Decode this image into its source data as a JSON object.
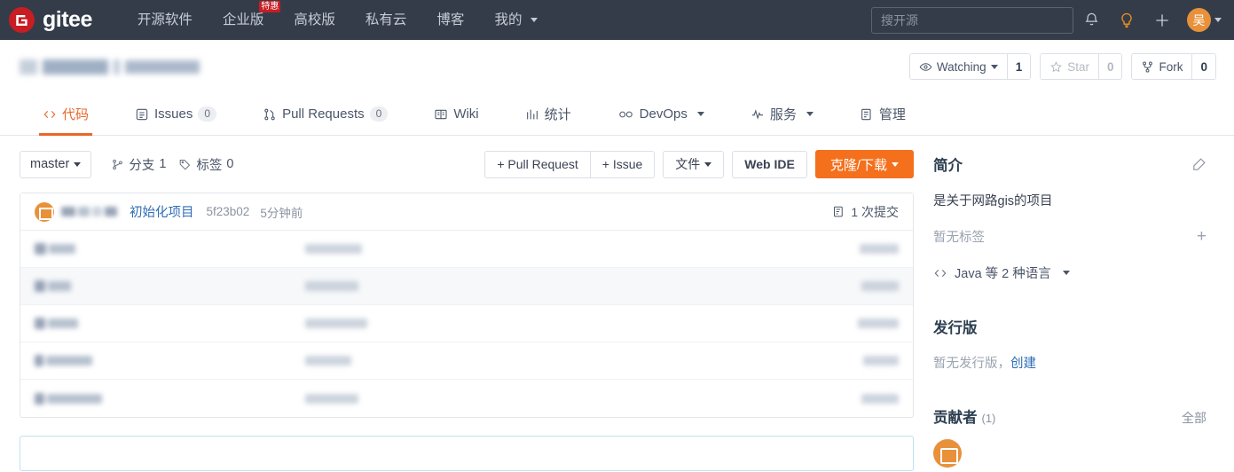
{
  "topnav": {
    "logo_text": "gitee",
    "links": [
      {
        "label": "开源软件",
        "badge": ""
      },
      {
        "label": "企业版",
        "badge": "特惠"
      },
      {
        "label": "高校版",
        "badge": ""
      },
      {
        "label": "私有云",
        "badge": ""
      },
      {
        "label": "博客",
        "badge": ""
      },
      {
        "label": "我的",
        "badge": "",
        "caret": true
      }
    ],
    "search_placeholder": "搜开源",
    "search_value": "",
    "icons": [
      "bell-icon",
      "lightbulb-icon",
      "plus-icon"
    ],
    "avatar_text": "吴"
  },
  "repo": {
    "title_redacted": true,
    "watch_label": "Watching",
    "watch_count": "1",
    "star_label": "Star",
    "star_count": "0",
    "fork_label": "Fork",
    "fork_count": "0"
  },
  "tabs": [
    {
      "label": "代码",
      "icon": "code-icon",
      "count": "",
      "active": true
    },
    {
      "label": "Issues",
      "icon": "issue-icon",
      "count": "0",
      "active": false
    },
    {
      "label": "Pull Requests",
      "icon": "pr-icon",
      "count": "0",
      "active": false
    },
    {
      "label": "Wiki",
      "icon": "book-icon",
      "count": "",
      "active": false
    },
    {
      "label": "统计",
      "icon": "chart-icon",
      "count": "",
      "active": false
    },
    {
      "label": "DevOps",
      "icon": "infinity-icon",
      "count": "",
      "active": false,
      "caret": true
    },
    {
      "label": "服务",
      "icon": "pulse-icon",
      "count": "",
      "active": false,
      "caret": true
    },
    {
      "label": "管理",
      "icon": "settings-icon",
      "count": "",
      "active": false
    }
  ],
  "toolbar": {
    "branch": "master",
    "branches_label": "分支",
    "branches_count": "1",
    "tags_label": "标签",
    "tags_count": "0",
    "pull_request_btn": "+ Pull Request",
    "issue_btn": "+ Issue",
    "files_btn": "文件",
    "web_ide_btn": "Web IDE",
    "clone_btn": "克隆/下载"
  },
  "commit": {
    "message": "初始化项目",
    "sha": "5f23b02",
    "time": "5分钟前",
    "count_label": "1 次提交"
  },
  "files": [
    {
      "redacted": true,
      "hover": false
    },
    {
      "redacted": true,
      "hover": true
    },
    {
      "redacted": true,
      "hover": false
    },
    {
      "redacted": true,
      "hover": false
    },
    {
      "redacted": true,
      "hover": false
    }
  ],
  "sidebar": {
    "intro_title": "简介",
    "intro_desc": "是关于网路gis的项目",
    "no_tags": "暂无标签",
    "language": "Java 等 2 种语言",
    "releases_title": "发行版",
    "releases_empty": "暂无发行版，",
    "releases_create": "创建",
    "contributors_title": "贡献者",
    "contributors_count": "(1)",
    "contributors_all": "全部"
  },
  "colors": {
    "nav_bg": "#353c49",
    "brand_red": "#c71d23",
    "accent_orange": "#f4701d",
    "tab_active": "#e8672b",
    "link_blue": "#2f6db5"
  }
}
